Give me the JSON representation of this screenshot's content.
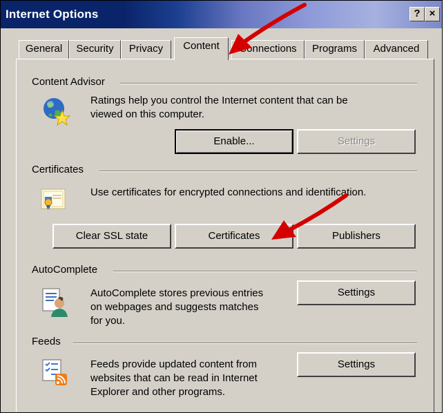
{
  "window": {
    "title": "Internet Options",
    "help_label": "?",
    "close_label": "×"
  },
  "tabs": [
    {
      "label": "General"
    },
    {
      "label": "Security"
    },
    {
      "label": "Privacy"
    },
    {
      "label": "Content",
      "active": true
    },
    {
      "label": "Connections"
    },
    {
      "label": "Programs"
    },
    {
      "label": "Advanced"
    }
  ],
  "content_advisor": {
    "title": "Content Advisor",
    "description_line1": "Ratings help you control the Internet content that can be",
    "description_line2": "viewed on this computer.",
    "enable_label": "Enable...",
    "settings_label": "Settings"
  },
  "certificates": {
    "title": "Certificates",
    "description": "Use certificates for encrypted connections and identification.",
    "clear_ssl_label": "Clear SSL state",
    "certificates_label": "Certificates",
    "publishers_label": "Publishers"
  },
  "autocomplete": {
    "title": "AutoComplete",
    "description_line1": "AutoComplete stores previous entries",
    "description_line2": "on webpages and suggests matches",
    "description_line3": "for you.",
    "settings_label": "Settings"
  },
  "feeds": {
    "title": "Feeds",
    "description_line1": "Feeds provide updated content from",
    "description_line2": "websites that can be read in Internet",
    "description_line3": "Explorer and other programs.",
    "settings_label": "Settings"
  },
  "icons": [
    "globe-star-icon",
    "certificate-icon",
    "autocomplete-user-icon",
    "feeds-icon"
  ],
  "annotation_color": "#d40000"
}
